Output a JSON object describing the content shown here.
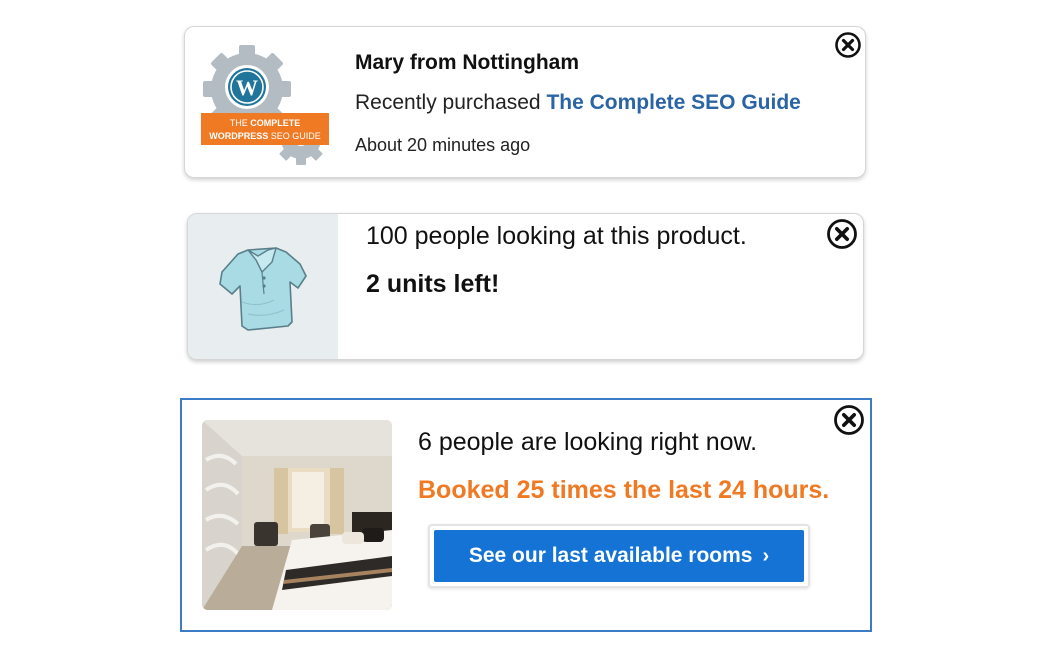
{
  "card1": {
    "thumb": {
      "icon": "wordpress-gear-logo",
      "banner_line1_a": "THE ",
      "banner_line1_b": "COMPLETE",
      "banner_line2_a": "WORDPRESS ",
      "banner_line2_b": "SEO GUIDE"
    },
    "name": "Mary from Nottingham",
    "purchase_prefix": "Recently purchased ",
    "product_link": "The Complete SEO Guide",
    "time": "About 20 minutes ago",
    "close_icon": "close-circle-x-icon"
  },
  "card2": {
    "thumb_icon": "polo-shirt-image",
    "looking": "100 people looking at this product.",
    "units": "2 units left!",
    "close_icon": "close-circle-x-icon"
  },
  "card3": {
    "photo_icon": "hotel-room-photo",
    "looking": "6 people are looking right now.",
    "booked": "Booked 25 times the last 24 hours.",
    "cta_label": "See our last available rooms",
    "cta_chevron": "›",
    "close_icon": "close-circle-x-icon"
  },
  "colors": {
    "link_blue": "#2a64a5",
    "accent_orange": "#f07a23",
    "button_blue": "#1473d4",
    "frame_blue": "#3b7bc8"
  }
}
